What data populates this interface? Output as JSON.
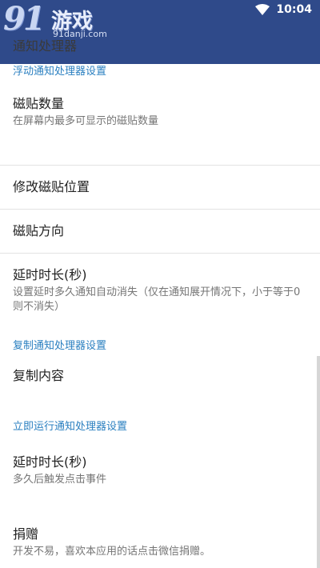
{
  "status_bar": {
    "time": "10:04",
    "wifi_icon": "wifi-icon"
  },
  "app_bar": {
    "title": "通知处理器"
  },
  "watermark": {
    "logo_digits": "91",
    "logo_text": "游戏",
    "logo_url": "91danji.com"
  },
  "sections": {
    "floating": {
      "header": "浮动通知处理器设置",
      "tile_count": {
        "title": "磁贴数量",
        "summary": "在屏幕内最多可显示的磁贴数量"
      },
      "tile_position": {
        "title": "修改磁贴位置"
      },
      "tile_direction": {
        "title": "磁贴方向"
      },
      "delay": {
        "title": "延时时长(秒)",
        "summary": "设置延时多久通知自动消失（仅在通知展开情况下，小于等于0则不消失）"
      }
    },
    "copy": {
      "header": "复制通知处理器设置",
      "content": {
        "title": "复制内容"
      }
    },
    "run_now": {
      "header": "立即运行通知处理器设置",
      "delay": {
        "title": "延时时长(秒)",
        "summary": "多久后触发点击事件"
      }
    },
    "donate": {
      "title": "捐赠",
      "summary": "开发不易，喜欢本应用的话点击微信捐赠。"
    }
  }
}
